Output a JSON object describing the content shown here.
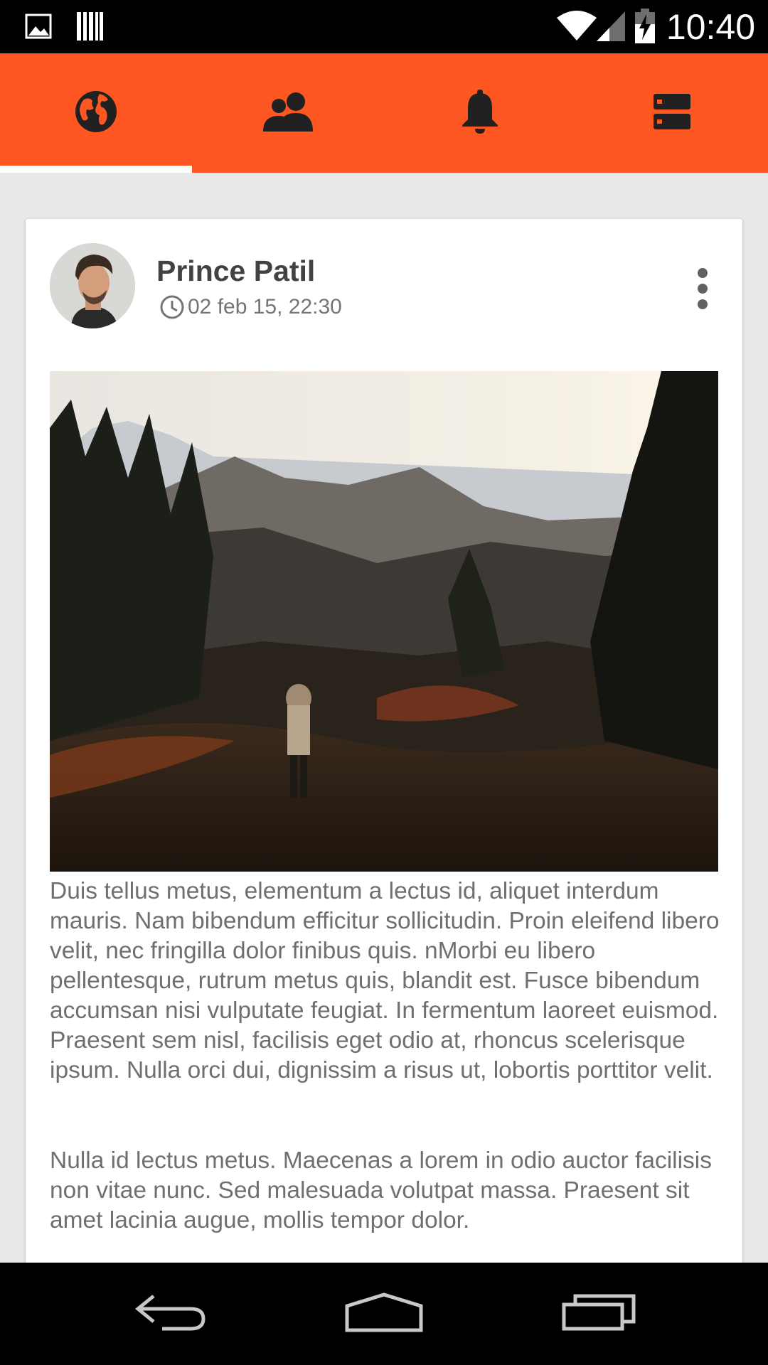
{
  "status_bar": {
    "time": "10:40",
    "icons": [
      "gallery-icon",
      "barcode-icon",
      "wifi-icon",
      "signal-icon",
      "battery-charging-icon"
    ]
  },
  "tabs": [
    {
      "name": "globe-icon",
      "selected": true
    },
    {
      "name": "people-icon",
      "selected": false
    },
    {
      "name": "bell-icon",
      "selected": false
    },
    {
      "name": "dashboard-icon",
      "selected": false
    }
  ],
  "post": {
    "author": "Prince Patil",
    "timestamp": "02 feb 15, 22:30",
    "paragraphs": [
      "Duis tellus metus, elementum a lectus id, aliquet interdum mauris. Nam bibendum efficitur sollicitudin. Proin eleifend libero velit, nec fringilla dolor finibus quis. nMorbi eu libero pellentesque, rutrum metus quis, blandit est. Fusce bibendum accumsan nisi vulputate feugiat. In fermentum laoreet euismod. Praesent sem nisl, facilisis eget odio at, rhoncus scelerisque ipsum. Nulla orci dui, dignissim a risus ut, lobortis porttitor velit.",
      "Nulla id lectus metus. Maecenas a lorem in odio auctor facilisis non vitae nunc. Sed malesuada volutpat massa. Praesent sit amet lacinia augue, mollis tempor dolor."
    ]
  },
  "nav_bar": {
    "buttons": [
      "back-icon",
      "home-icon",
      "recents-icon"
    ]
  },
  "colors": {
    "accent": "#ff5722",
    "icon_dark": "#212121",
    "background": "#e8e8e8",
    "card": "#ffffff",
    "text_body": "#6f6f6f",
    "text_name": "#424242"
  }
}
